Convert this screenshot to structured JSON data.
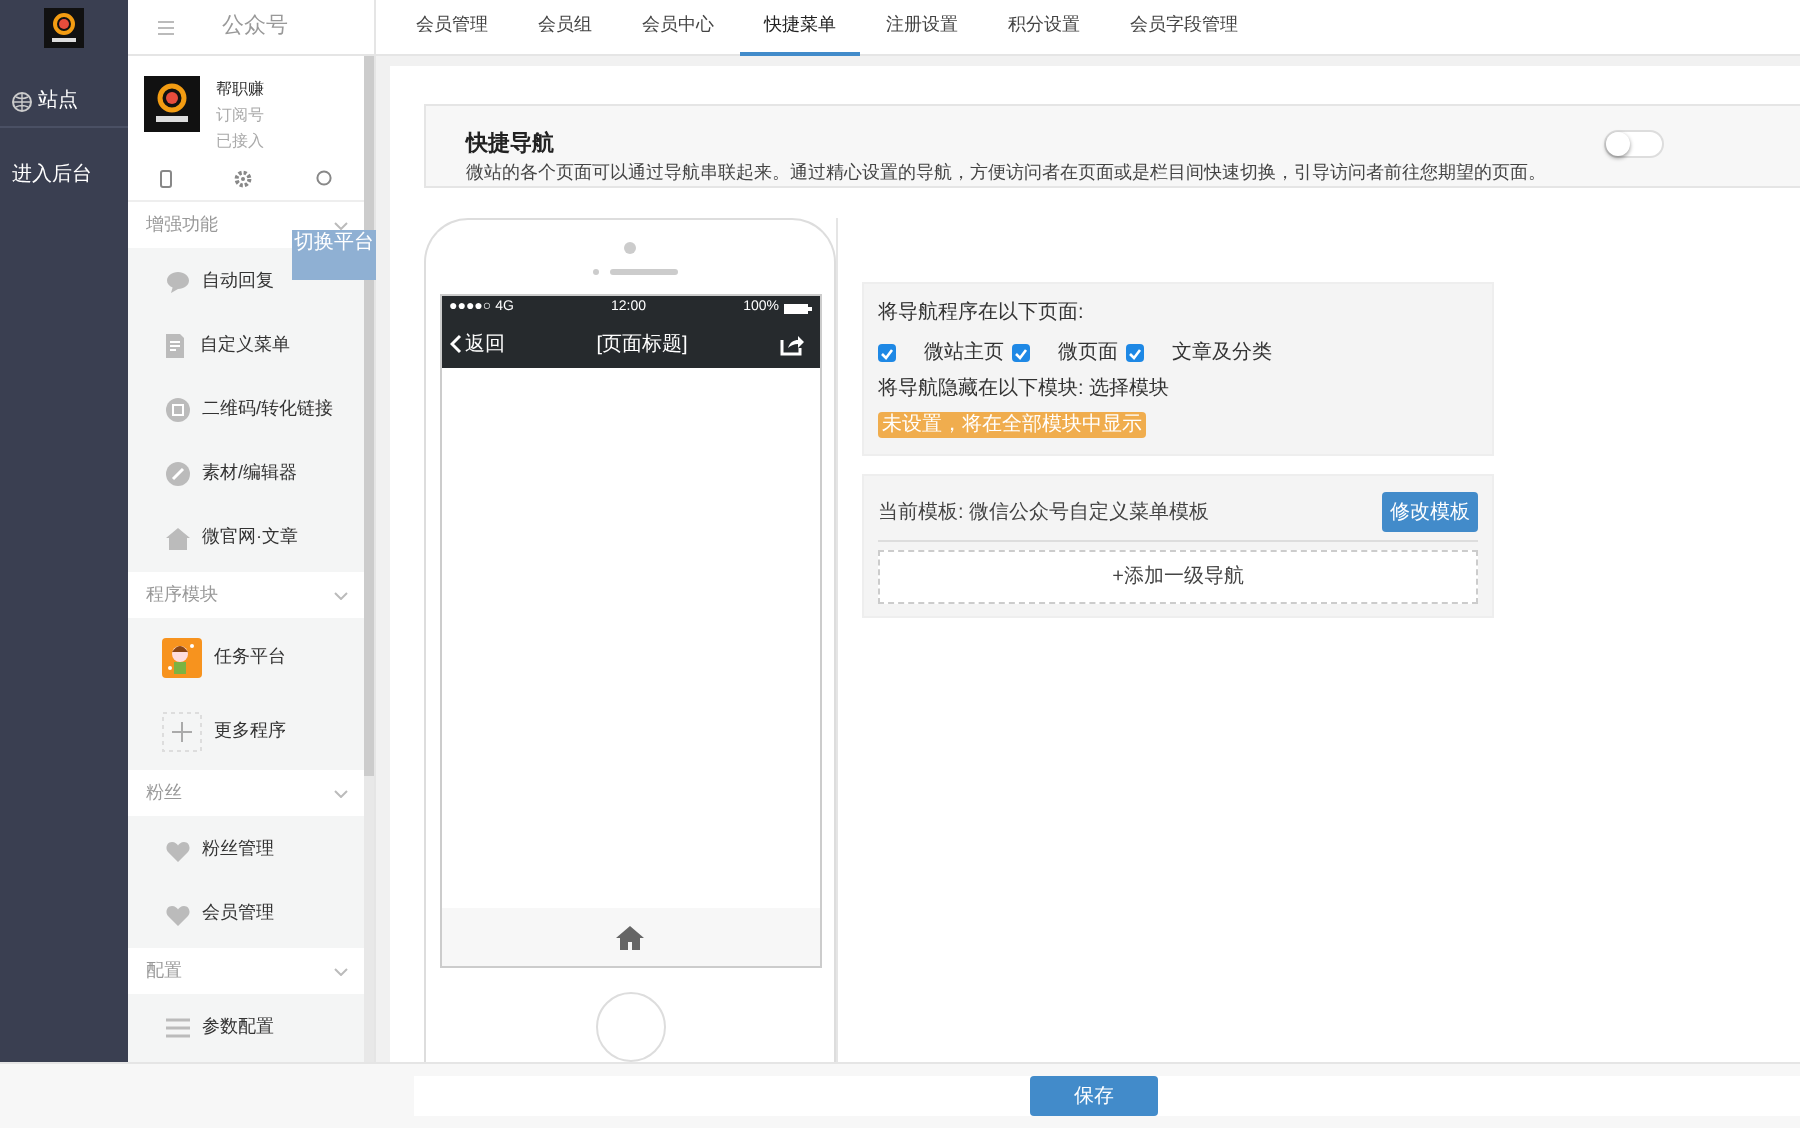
{
  "rail": {
    "items": [
      {
        "label": "站点"
      },
      {
        "label": "进入后台"
      }
    ]
  },
  "sidebar": {
    "title": "公众号",
    "account": {
      "name": "帮职赚",
      "type": "订阅号",
      "status": "已接入"
    },
    "tooltip": "切换平台",
    "sections": [
      {
        "title": "增强功能",
        "items": [
          {
            "label": "自动回复"
          },
          {
            "label": "自定义菜单"
          },
          {
            "label": "二维码/转化链接"
          },
          {
            "label": "素材/编辑器"
          },
          {
            "label": "微官网·文章"
          }
        ]
      },
      {
        "title": "程序模块",
        "items": [
          {
            "label": "任务平台",
            "kind": "app"
          },
          {
            "label": "更多程序",
            "kind": "add"
          }
        ]
      },
      {
        "title": "粉丝",
        "items": [
          {
            "label": "粉丝管理"
          },
          {
            "label": "会员管理"
          }
        ]
      },
      {
        "title": "配置",
        "items": [
          {
            "label": "参数配置"
          }
        ]
      }
    ]
  },
  "tabs": [
    {
      "label": "会员管理",
      "selected": false
    },
    {
      "label": "会员组",
      "selected": false
    },
    {
      "label": "会员中心",
      "selected": false
    },
    {
      "label": "快捷菜单",
      "selected": true
    },
    {
      "label": "注册设置",
      "selected": false
    },
    {
      "label": "积分设置",
      "selected": false
    },
    {
      "label": "会员字段管理",
      "selected": false
    }
  ],
  "quick_nav": {
    "title": "快捷导航",
    "description": "微站的各个页面可以通过导航串联起来。通过精心设置的导航，方便访问者在页面或是栏目间快速切换，引导访问者前往您期望的页面。",
    "on": false
  },
  "phone": {
    "signal": "●●●●○ 4G",
    "time": "12:00",
    "battery": "100%",
    "back": "返回",
    "title": "[页面标题]"
  },
  "settings": {
    "pages_label": "将导航程序在以下页面:",
    "pages": [
      {
        "label": "微站主页",
        "checked": true
      },
      {
        "label": "微页面",
        "checked": true
      },
      {
        "label": "文章及分类",
        "checked": true
      }
    ],
    "hide_label": "将导航隐藏在以下模块: 选择模块",
    "notice": "未设置，将在全部模块中显示"
  },
  "template": {
    "current": "当前模板: 微信公众号自定义菜单模板",
    "button": "修改模板",
    "add": "+添加一级导航"
  },
  "save": "保存"
}
